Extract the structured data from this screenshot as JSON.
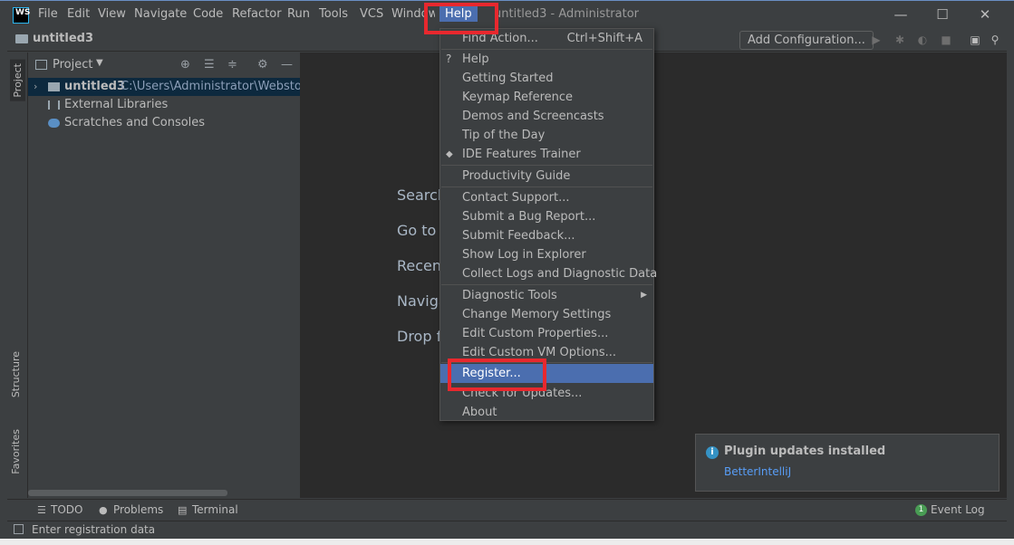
{
  "logo": {
    "text_top": "WS",
    "text_bottom": ""
  },
  "menu": [
    "File",
    "Edit",
    "View",
    "Navigate",
    "Code",
    "Refactor",
    "Run",
    "Tools",
    "VCS",
    "Window",
    "Help"
  ],
  "window_title": "untitled3 - Administrator",
  "window_controls": {
    "minimize": "—",
    "maximize": "☐",
    "close": "✕"
  },
  "navbar": {
    "project": "untitled3",
    "add_configuration": "Add Configuration..."
  },
  "left_stripe": {
    "project": "Project",
    "structure": "Structure",
    "favorites": "Favorites"
  },
  "project_panel": {
    "header": "Project",
    "tree": [
      {
        "name": "untitled3",
        "path": "C:\\Users\\Administrator\\Webstorm"
      },
      {
        "name": "External Libraries"
      },
      {
        "name": "Scratches and Consoles"
      }
    ]
  },
  "editor_hints": [
    "Search",
    "Go to",
    "Recen",
    "Naviga",
    "Drop f"
  ],
  "help_menu": {
    "items": [
      {
        "label": "Find Action...",
        "shortcut": "Ctrl+Shift+A"
      },
      {
        "label": "Help",
        "icon": "question-icon"
      },
      {
        "label": "Getting Started"
      },
      {
        "label": "Keymap Reference"
      },
      {
        "label": "Demos and Screencasts"
      },
      {
        "label": "Tip of the Day"
      },
      {
        "label": "IDE Features Trainer",
        "icon": "graduation-cap-icon"
      },
      {
        "label": "Productivity Guide"
      },
      {
        "label": "Contact Support..."
      },
      {
        "label": "Submit a Bug Report..."
      },
      {
        "label": "Submit Feedback..."
      },
      {
        "label": "Show Log in Explorer"
      },
      {
        "label": "Collect Logs and Diagnostic Data"
      },
      {
        "label": "Diagnostic Tools"
      },
      {
        "label": "Change Memory Settings"
      },
      {
        "label": "Edit Custom Properties..."
      },
      {
        "label": "Edit Custom VM Options..."
      },
      {
        "label": "Register...",
        "selected": true
      },
      {
        "label": "Check for Updates..."
      },
      {
        "label": "About"
      }
    ]
  },
  "notification": {
    "title": "Plugin updates installed",
    "link": "BetterIntelliJ"
  },
  "bottom_bar": {
    "todo": "TODO",
    "problems": "Problems",
    "terminal": "Terminal",
    "event_log": "Event Log",
    "event_log_count": "1"
  },
  "status_bar": {
    "text": "Enter registration data"
  },
  "colors": {
    "menu_selection": "#4b6eaf",
    "highlight_box": "#e8282e",
    "editor_bg": "#2b2b2b",
    "panel_bg": "#3c3f41",
    "link": "#589df6"
  }
}
